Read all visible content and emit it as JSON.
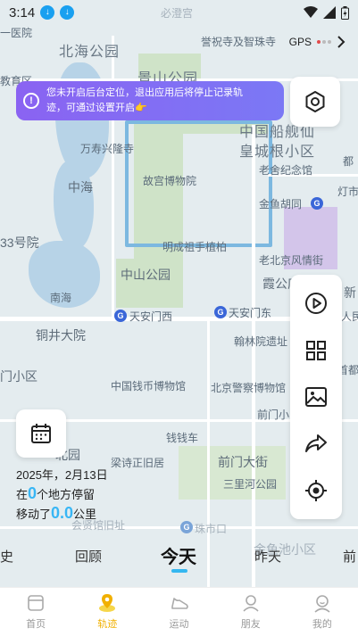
{
  "status_bar": {
    "time": "3:14"
  },
  "gps": {
    "label": "GPS"
  },
  "notice": {
    "text_line1": "您未开启后台定位，退出应用后将停止记录轨",
    "text_line2": "迹，可通过设置开启👉"
  },
  "map": {
    "labels": {
      "l1": "北海公园",
      "l2": "景山公园",
      "l3": "一医院",
      "l4": "教育区",
      "l5": "誉祝寺及智珠寺",
      "l6": "中国船舰仙",
      "l7": "皇城根小区",
      "l8": "万寿兴隆寺",
      "l9": "故宫博物院",
      "l10": "老舍纪念馆",
      "l11": "中海",
      "l12": "金鱼胡同",
      "l13": "33号院",
      "l14": "明成祖手植柏",
      "l15": "中山公园",
      "l16": "老北京风情街",
      "l17": "南海",
      "l18": "霞公府",
      "l19": "天安门西",
      "l20": "天安门东",
      "l21": "铜井大院",
      "l22": "翰林院遗址",
      "l23": "门小区",
      "l24": "中国钱币博物馆",
      "l25": "北京警察博物馆",
      "l26": "前门小区",
      "l27": "钱钱车",
      "l28": "前门大街",
      "l29": "梁诗正旧居",
      "l30": "三里河公园",
      "l31": "会贤馆旧址",
      "l32": "珠市口",
      "l33": "金鱼池小区",
      "l34": "都",
      "l35": "灯市",
      "l36": "新",
      "l37": "人民",
      "l38": "首都",
      "l39": "北园",
      "l40": "必澄宫",
      "l41": "灯市"
    }
  },
  "summary": {
    "date": "2025年，2月13日",
    "stay_prefix": "在",
    "stay_count": "0",
    "stay_suffix": "个地方停留",
    "move_prefix": "移动了",
    "move_distance": "0.0",
    "move_suffix": "公里"
  },
  "date_tabs": {
    "history": "史",
    "review": "回顾",
    "today": "今天",
    "yesterday": "昨天",
    "before": "前"
  },
  "bottom_nav": [
    {
      "label": "首页",
      "icon": "home-icon"
    },
    {
      "label": "轨迹",
      "icon": "track-pin-icon"
    },
    {
      "label": "运动",
      "icon": "shoe-icon"
    },
    {
      "label": "朋友",
      "icon": "friends-icon"
    },
    {
      "label": "我的",
      "icon": "profile-icon"
    }
  ],
  "colors": {
    "accent": "#35b7f0",
    "nav_active": "#f1b000",
    "notice_start": "#8a63f2",
    "notice_end": "#7b78f5"
  }
}
